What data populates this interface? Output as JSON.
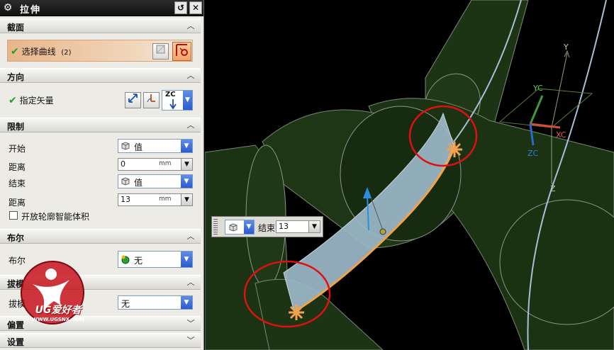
{
  "dialog": {
    "title": "拉伸",
    "reset_glyph": "↺",
    "close_glyph": "✕"
  },
  "sections": {
    "section": "截面",
    "direction": "方向",
    "limits": "限制",
    "boolean": "布尔",
    "draft": "拔模",
    "offset": "偏置",
    "settings": "设置"
  },
  "section_group": {
    "select_curve_label": "选择曲线",
    "select_curve_count": "(2)"
  },
  "direction_group": {
    "specify_vector_label": "指定矢量",
    "vector_value": "ZC"
  },
  "limits_group": {
    "start_label": "开始",
    "start_option": "值",
    "start_distance_label": "距离",
    "start_distance_value": "0",
    "end_label": "结束",
    "end_option": "值",
    "end_distance_label": "距离",
    "end_distance_value": "13",
    "unit": "mm",
    "open_profile_label": "开放轮廓智能体积"
  },
  "boolean_group": {
    "label": "布尔",
    "value": "无"
  },
  "draft_group": {
    "label": "拔模",
    "value": "无"
  },
  "float_widget": {
    "label": "结束",
    "value": "13"
  },
  "csys": {
    "y": "Y",
    "yc": "YC",
    "xc": "XC",
    "zc": "ZC",
    "z": "Z"
  },
  "watermark": {
    "brand": "UG爱好者",
    "url": "WWW.UGSNX.COM"
  },
  "colors": {
    "viewport_bg": "#000000",
    "tube_fill": "#1d3414",
    "sheet": "#9cb9c9",
    "edge": "#f2a24a",
    "highlight_ring": "#e01010",
    "accent": "#e6a070"
  }
}
